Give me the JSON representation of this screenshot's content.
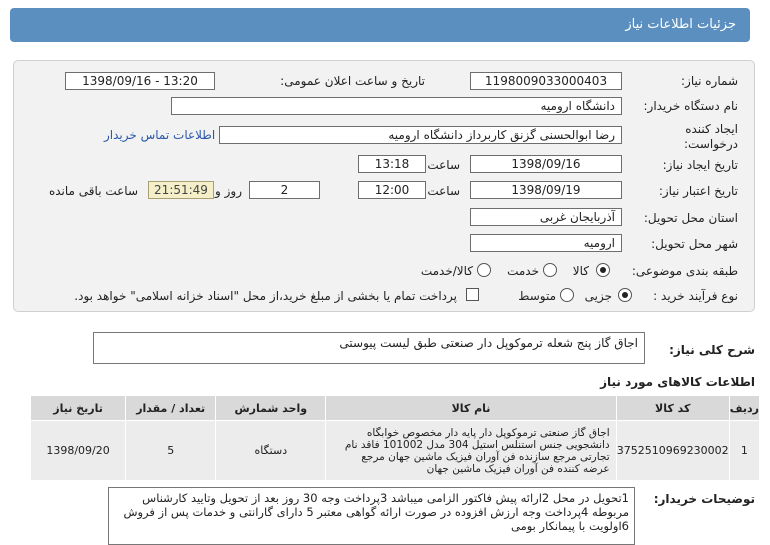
{
  "header": {
    "title": "جزئیات اطلاعات نیاز"
  },
  "form": {
    "need_number_label": "شماره نیاز:",
    "need_number": "1198009033000403",
    "announce_label": "تاریخ و ساعت اعلان عمومی:",
    "announce_value": "1398/09/16 - 13:20",
    "buyer_label": "نام دستگاه خریدار:",
    "buyer_value": "دانشگاه ارومیه",
    "creator_label_1": "ایجاد کننده",
    "creator_label_2": "درخواست:",
    "creator_value": "رضا ابوالحسنی گزنق کاربرداز دانشگاه ارومیه",
    "contact_link": "اطلاعات تماس خریدار",
    "create_date_label": "تاریخ ایجاد نیاز:",
    "create_date": "1398/09/16",
    "time_label": "ساعت",
    "create_time": "13:18",
    "valid_date_label": "تاریخ اعتبار نیاز:",
    "valid_date": "1398/09/19",
    "valid_time": "12:00",
    "days_value": "2",
    "days_label": "روز و",
    "remaining_time": "21:51:49",
    "remaining_label": "ساعت باقی مانده",
    "province_label": "استان محل تحویل:",
    "province_value": "آذربایجان غربی",
    "city_label": "شهر محل تحویل:",
    "city_value": "ارومیه",
    "category_label": "طبقه بندی موضوعی:",
    "category_options": [
      "کالا",
      "خدمت",
      "کالا/خدمت"
    ],
    "process_label": "نوع فرآیند خرید :",
    "process_options": [
      "جزیی",
      "متوسط"
    ],
    "payment_note": "پرداخت تمام یا بخشی از مبلغ خرید،از محل \"اسناد خزانه اسلامی\" خواهد بود."
  },
  "description": {
    "label": "شرح کلی نیاز:",
    "text": "اجاق گاز پنج شعله ترموکوپل دار صنعتی طبق لیست پیوستی"
  },
  "items": {
    "title": "اطلاعات کالاهای مورد نیاز",
    "headers": [
      "ردیف",
      "کد کالا",
      "نام کالا",
      "واحد شمارش",
      "تعداد / مقدار",
      "تاریخ نیاز"
    ],
    "rows": [
      {
        "row": "1",
        "code": "3752510969230002",
        "name": "اجاق گاز صنعتی ترموکوپل دار پایه دار مخصوص خوابگاه دانشجویی جنس استنلس استیل 304 مدل 101002 فاقد نام تجارتی مرجع سازنده فن آوران فیزیک ماشین جهان مرجع عرضه کننده فن آوران فیزیک ماشین جهان",
        "unit": "دستگاه",
        "qty": "5",
        "date": "1398/09/20"
      }
    ]
  },
  "notes": {
    "label": "توضیحات خریدار:",
    "text": "1تحویل در محل 2ارائه پیش فاکتور الزامی میباشد 3پرداخت وجه 30 روز بعد از تحویل وتایید کارشناس مربوطه 4پرداخت وجه ارزش افزوده در صورت ارائه گواهی معتبر 5 دارای گارانتی و خدمات پس از فروش 6اولویت با پیمانکار بومی"
  }
}
